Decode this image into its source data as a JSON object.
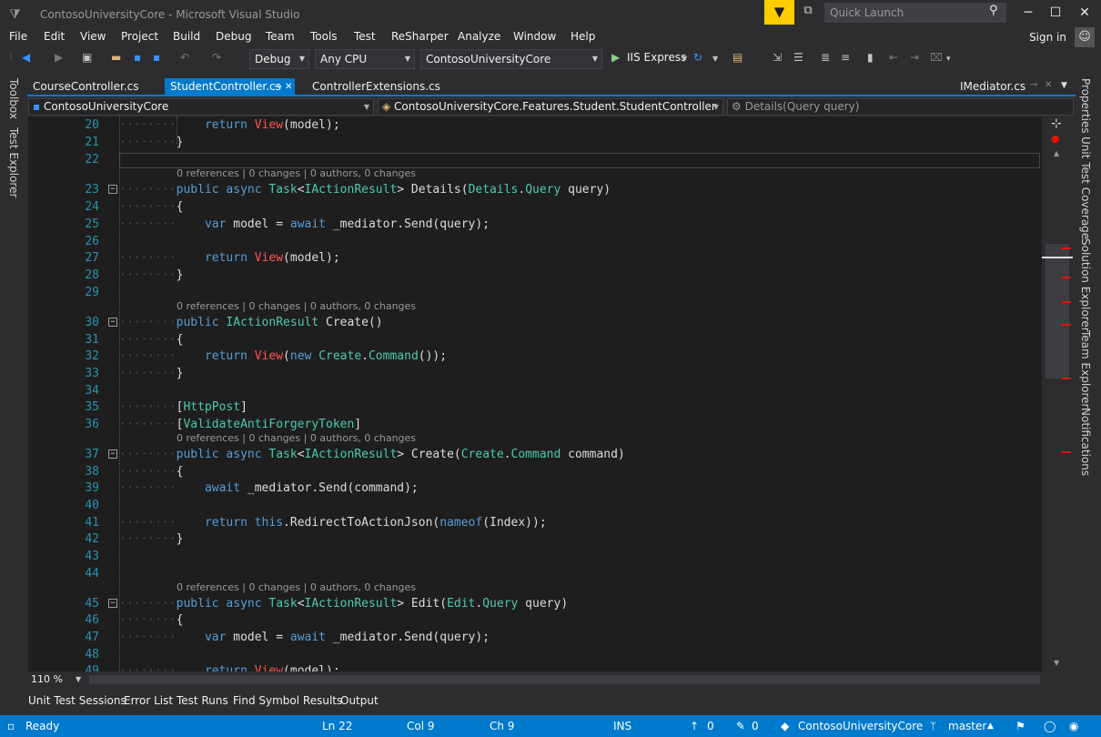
{
  "window": {
    "title": "ContosoUniversityCore - Microsoft Visual Studio",
    "quick_launch_placeholder": "Quick Launch",
    "minimize": "─",
    "maximize": "☐",
    "close": "✕"
  },
  "menu": [
    "File",
    "Edit",
    "View",
    "Project",
    "Build",
    "Debug",
    "Team",
    "Tools",
    "Test",
    "ReSharper",
    "Analyze",
    "Window",
    "Help"
  ],
  "signin": "Sign in",
  "toolbar": {
    "configuration": "Debug",
    "platform": "Any CPU",
    "startup_project": "ContosoUniversityCore",
    "run_target": "IIS Express"
  },
  "tabs": [
    {
      "label": "CourseController.cs",
      "active": false
    },
    {
      "label": "StudentController.cs",
      "active": true,
      "pin": "⊸",
      "close": "✕"
    },
    {
      "label": "ControllerExtensions.cs",
      "active": false
    },
    {
      "label": "IMediator.cs",
      "active": false
    }
  ],
  "nav": {
    "project": "ContosoUniversityCore",
    "type": "ContosoUniversityCore.Features.Student.StudentController",
    "member": "Details(Query query)"
  },
  "left_panels": [
    "Toolbox",
    "Test Explorer"
  ],
  "right_panels": [
    "Properties",
    "Unit Test Coverage",
    "Solution Explorer",
    "Team Explorer",
    "Notifications"
  ],
  "code_lens": {
    "l23": "0 references | 0 changes | 0 authors, 0 changes",
    "l30": "0 references | 0 changes | 0 authors, 0 changes",
    "l37": "0 references | 0 changes | 0 authors, 0 changes",
    "l45": "0 references | 0 changes | 0 authors, 0 changes"
  },
  "line_numbers": [
    "20",
    "21",
    "22",
    "23",
    "24",
    "25",
    "26",
    "27",
    "28",
    "29",
    "30",
    "31",
    "32",
    "33",
    "34",
    "35",
    "36",
    "37",
    "38",
    "39",
    "40",
    "41",
    "42",
    "43",
    "44",
    "45",
    "46",
    "47",
    "48",
    "49"
  ],
  "zoom": "110 %",
  "bottom_tabs": [
    "Unit Test Sessions",
    "Error List",
    "Test Runs",
    "Find Symbol Results",
    "Output"
  ],
  "status": {
    "state": "Ready",
    "line": "Ln 22",
    "col": "Col 9",
    "ch": "Ch 9",
    "mode": "INS",
    "up_count": "0",
    "pencil_count": "0",
    "repo": "ContosoUniversityCore",
    "branch": "master"
  },
  "colors": {
    "accent": "#007acc",
    "editor_bg": "#1e1e1e",
    "keyword": "#569cd6",
    "type": "#4ec9b0",
    "method_highlight": "#ff5555",
    "filter": "#ffcc00"
  }
}
